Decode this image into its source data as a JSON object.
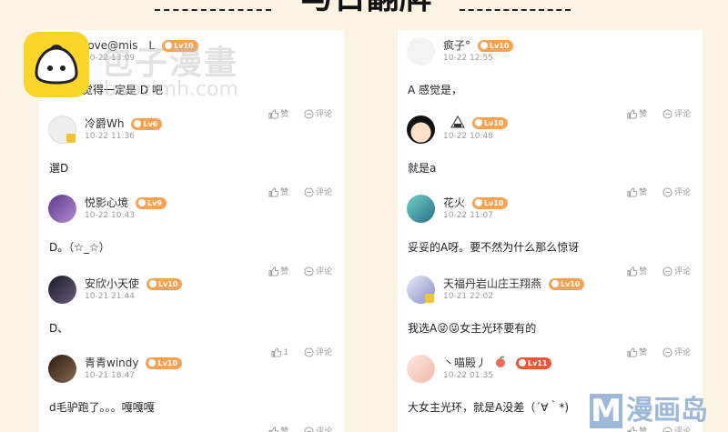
{
  "header": {
    "title": "与日翻牌"
  },
  "watermark": {
    "site_cn": "包子漫畫",
    "site_url": "baozimh.com",
    "brand_letter": "M",
    "brand_name": "漫画岛"
  },
  "colors": {
    "level_badge": "#f5a352",
    "level_badge_red": "#e8573a",
    "page_bg": "#fbf3e3",
    "card_bg": "#ffffff"
  },
  "labels": {
    "like": "赞",
    "reply": "评论"
  },
  "left_comments": [
    {
      "name": "love@mis　L",
      "level": "Lv10",
      "time": "10-22 13:09",
      "text": "我倒是觉得一定是 D 吧",
      "likes": ""
    },
    {
      "name": "冷爵Wh",
      "level": "Lv6",
      "time": "10-22 11:36",
      "text": "選D",
      "likes": ""
    },
    {
      "name": "悦影心境",
      "level": "Lv9",
      "time": "10-22 10:43",
      "text": "D。（☆_☆）",
      "likes": ""
    },
    {
      "name": "安欣小天使",
      "level": "Lv10",
      "time": "10-21 21:44",
      "text": "D、",
      "likes": "1"
    },
    {
      "name": "青青windy",
      "level": "Lv10",
      "time": "10-21 18:47",
      "text": "d毛驴跑了。。。嘎嘎嘎",
      "likes": ""
    }
  ],
  "right_comments": [
    {
      "name": "疯子°",
      "level": "Lv10",
      "time": "10-22 12:55",
      "text": "A 感觉是，",
      "likes": ""
    },
    {
      "name": "",
      "level": "Lv10",
      "time": "10-22 10:48",
      "text": "就是a",
      "likes": ""
    },
    {
      "name": "花火",
      "level": "Lv10",
      "time": "10-22 11:07",
      "text": "妥妥的A呀。要不然为什么那么惊讶",
      "likes": ""
    },
    {
      "name": "天福丹岩山庄王翔燕",
      "level": "Lv10",
      "time": "10-21 22:02",
      "text": "我选A😜😜女主光环要有的",
      "likes": ""
    },
    {
      "name": "丶喵殿丿",
      "level": "Lv11",
      "time": "10-22 01:35",
      "text": "大女主光环，就是A没差（´∀｀*)",
      "likes": ""
    }
  ]
}
